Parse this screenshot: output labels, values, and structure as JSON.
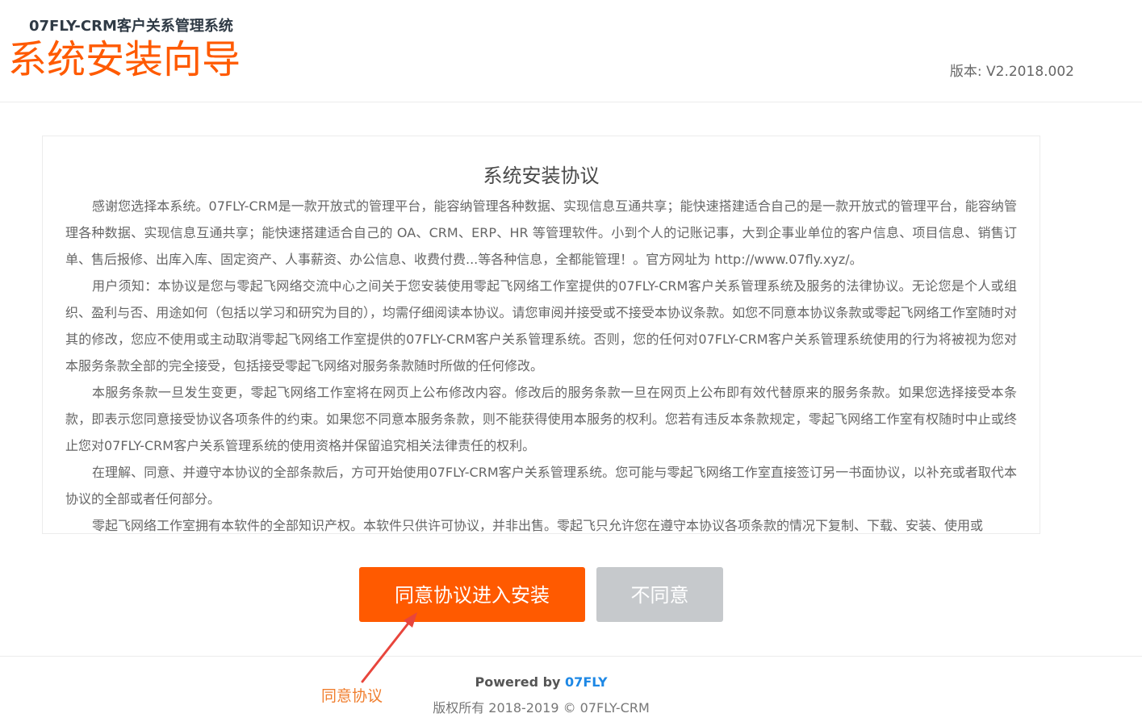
{
  "header": {
    "brand_subtitle": "07FLY-CRM客户关系管理系统",
    "page_title": "系统安装向导",
    "version": "版本: V2.2018.002"
  },
  "agreement": {
    "title": "系统安装协议",
    "paragraphs": [
      "感谢您选择本系统。07FLY-CRM是一款开放式的管理平台，能容纳管理各种数据、实现信息互通共享；能快速搭建适合自己的是一款开放式的管理平台，能容纳管理各种数据、实现信息互通共享；能快速搭建适合自己的 OA、CRM、ERP、HR 等管理软件。小到个人的记账记事，大到企事业单位的客户信息、项目信息、销售订单、售后报修、出库入库、固定资产、人事薪资、办公信息、收费付费...等各种信息，全都能管理！。官方网址为 http://www.07fly.xyz/。",
      "用户须知：本协议是您与零起飞网络交流中心之间关于您安装使用零起飞网络工作室提供的07FLY-CRM客户关系管理系统及服务的法律协议。无论您是个人或组织、盈利与否、用途如何（包括以学习和研究为目的），均需仔细阅读本协议。请您审阅并接受或不接受本协议条款。如您不同意本协议条款或零起飞网络工作室随时对其的修改，您应不使用或主动取消零起飞网络工作室提供的07FLY-CRM客户关系管理系统。否则，您的任何对07FLY-CRM客户关系管理系统使用的行为将被视为您对本服务条款全部的完全接受，包括接受零起飞网络对服务条款随时所做的任何修改。",
      "本服务条款一旦发生变更，零起飞网络工作室将在网页上公布修改内容。修改后的服务条款一旦在网页上公布即有效代替原来的服务条款。如果您选择接受本条款，即表示您同意接受协议各项条件的约束。如果您不同意本服务条款，则不能获得使用本服务的权利。您若有违反本条款规定，零起飞网络工作室有权随时中止或终止您对07FLY-CRM客户关系管理系统的使用资格并保留追究相关法律责任的权利。",
      "在理解、同意、并遵守本协议的全部条款后，方可开始使用07FLY-CRM客户关系管理系统。您可能与零起飞网络工作室直接签订另一书面协议，以补充或者取代本协议的全部或者任何部分。",
      "零起飞网络工作室拥有本软件的全部知识产权。本软件只供许可协议，并非出售。零起飞只允许您在遵守本协议各项条款的情况下复制、下载、安装、使用或"
    ]
  },
  "actions": {
    "agree_label": "同意协议进入安装",
    "disagree_label": "不同意"
  },
  "footer": {
    "powered_prefix": "Powered by ",
    "powered_brand": "07FLY",
    "copyright": "版权所有 2018-2019 © 07FLY-CRM"
  },
  "annotation": {
    "label": "同意协议",
    "color": "#f07e2e"
  },
  "colors": {
    "accent": "#ff5a00",
    "disabled": "#c6c9cc",
    "link": "#1e88e5"
  }
}
